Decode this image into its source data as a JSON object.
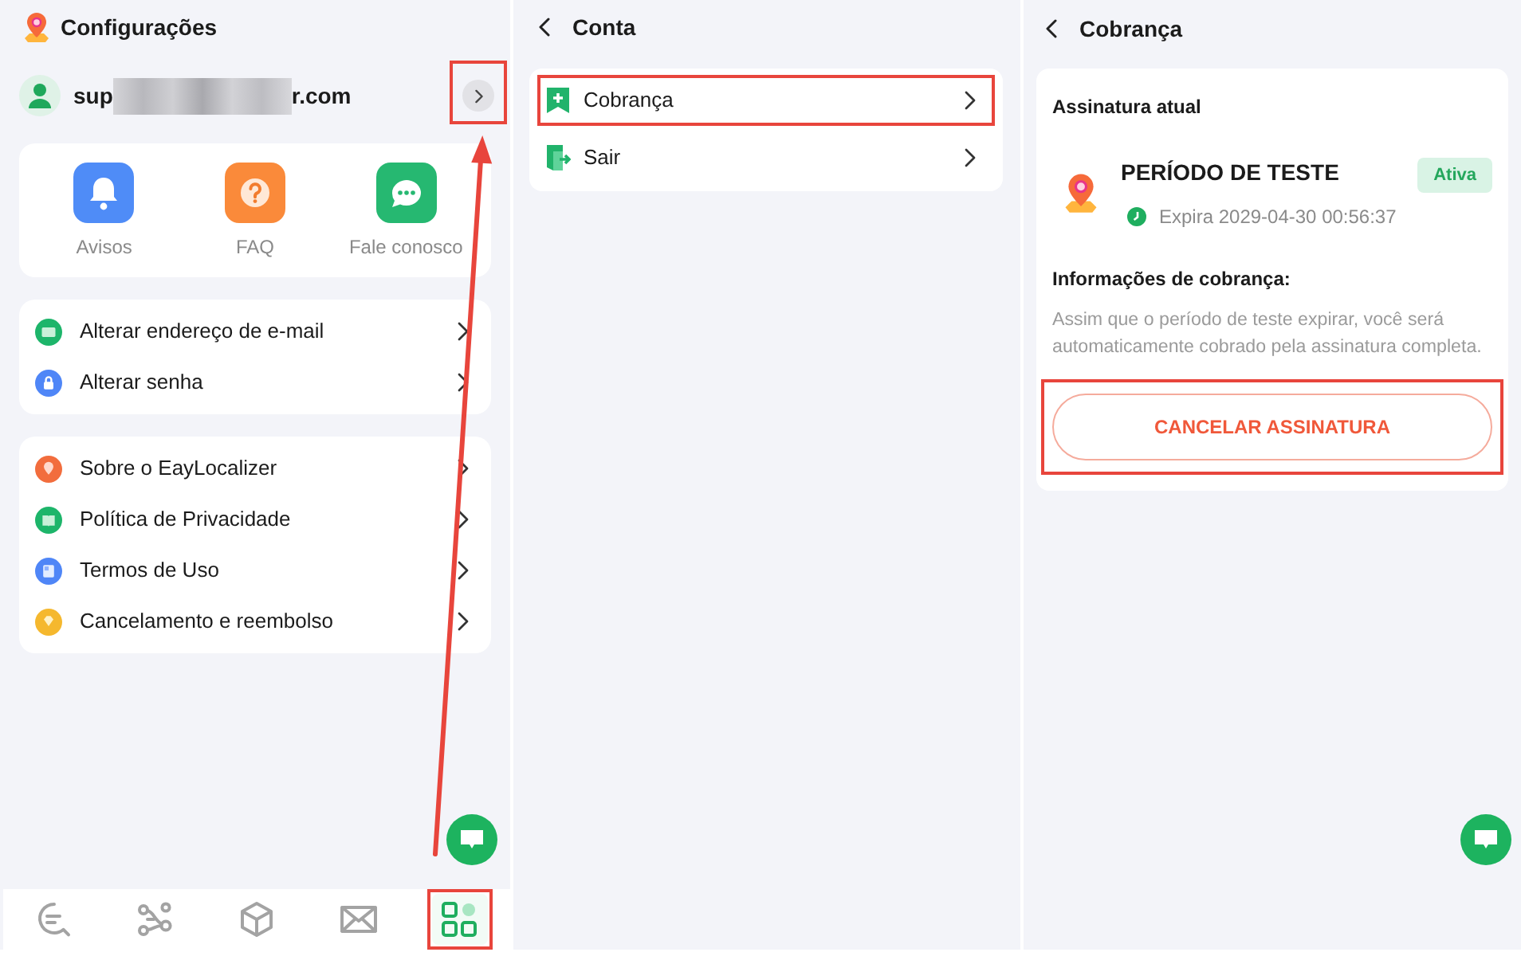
{
  "settings_screen": {
    "title": "Configurações",
    "account": {
      "email_start": "sup",
      "email_end": "r.com",
      "highlighted": true
    },
    "shortcuts": [
      {
        "kind": "bell",
        "label": "Avisos"
      },
      {
        "kind": "faq",
        "label": "FAQ"
      },
      {
        "kind": "chat",
        "label": "Fale conosco"
      }
    ],
    "account_menu": [
      {
        "kind": "email",
        "label": "Alterar endereço de e-mail"
      },
      {
        "kind": "lock",
        "label": "Alterar senha"
      }
    ],
    "info_menu": [
      {
        "kind": "pin",
        "label": "Sobre o EayLocalizer"
      },
      {
        "kind": "book",
        "label": "Política de Privacidade"
      },
      {
        "kind": "document",
        "label": "Termos de Uso"
      },
      {
        "kind": "diamond",
        "label": "Cancelamento e reembolso"
      }
    ],
    "annotation_arrow": true,
    "bottom_nav": [
      {
        "kind": "chat-search",
        "selected": false,
        "highlighted": false
      },
      {
        "kind": "nodes",
        "selected": false,
        "highlighted": false
      },
      {
        "kind": "cube",
        "selected": false,
        "highlighted": false
      },
      {
        "kind": "envelope",
        "selected": false,
        "highlighted": false
      },
      {
        "kind": "apps",
        "selected": true,
        "highlighted": true
      }
    ]
  },
  "account_screen": {
    "title": "Conta",
    "items": [
      {
        "kind": "billing",
        "label": "Cobrança",
        "highlighted": true
      },
      {
        "kind": "logout",
        "label": "Sair",
        "highlighted": false
      }
    ]
  },
  "billing_screen": {
    "title": "Cobrança",
    "section_title": "Assinatura atual",
    "plan": {
      "name": "PERÍODO DE TESTE",
      "status": "Ativa",
      "expiry": "Expira 2029-04-30 00:56:37"
    },
    "info_title": "Informações de cobrança:",
    "info_text": "Assim que o período de teste expirar, você será automaticamente cobrado pela assinatura completa.",
    "cancel_button": {
      "label": "CANCELAR ASSINATURA",
      "highlighted": true
    }
  }
}
